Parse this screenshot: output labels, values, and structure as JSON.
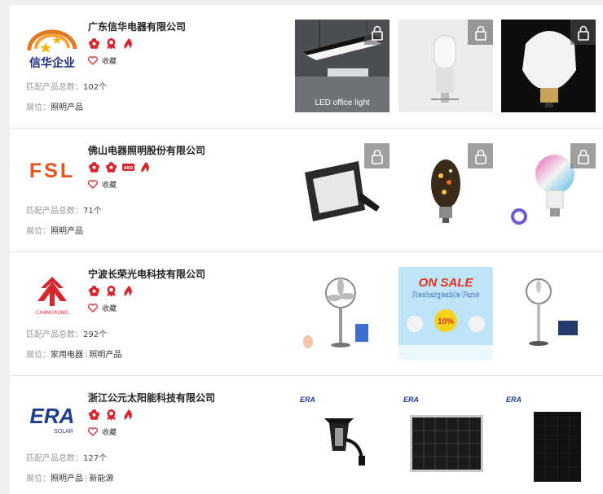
{
  "labels": {
    "favorite": "收藏",
    "product_count": "匹配产品总数：",
    "hall": "展位：",
    "count_suffix": "个"
  },
  "colors": {
    "badge_red": "#d8262e",
    "link": "#333333"
  },
  "companies": [
    {
      "name": "广东信华电器有限公司",
      "logo_text": "信华企业",
      "badges": [
        "flower-badge-icon",
        "award-badge-icon",
        "flame-badge-icon"
      ],
      "product_count": "102",
      "halls": [
        "照明产品"
      ],
      "thumbs": [
        {
          "icon": "led-office-light-image",
          "caption": "LED office light",
          "locked": true
        },
        {
          "icon": "led-corn-bulb-image",
          "caption": "",
          "locked": true
        },
        {
          "icon": "led-bulb-image",
          "caption": "",
          "locked": true
        }
      ]
    },
    {
      "name": "佛山电器照明股份有限公司",
      "logo_text": "FSL",
      "badges": [
        "flower-badge-icon",
        "flower-badge-icon",
        "aeo-badge-icon",
        "flame-badge-icon"
      ],
      "aeo_text": "AEO",
      "product_count": "71",
      "halls": [
        "照明产品"
      ],
      "thumbs": [
        {
          "icon": "floodlight-image",
          "caption": "",
          "locked": true
        },
        {
          "icon": "fireworks-bulb-image",
          "caption": "",
          "locked": true
        },
        {
          "icon": "rgb-smart-bulb-image",
          "caption": "",
          "locked": true
        }
      ]
    },
    {
      "name": "宁波长荣光电科技有限公司",
      "logo_text": "CHANGRONG",
      "badges": [
        "flower-badge-icon",
        "award-badge-icon",
        "flame-badge-icon"
      ],
      "product_count": "292",
      "halls": [
        "家用电器",
        "照明产品"
      ],
      "thumbs": [
        {
          "icon": "standing-fan-solar-image",
          "caption": "",
          "locked": false
        },
        {
          "icon": "rechargeable-fans-sale-image",
          "caption": "",
          "sale_title": "ON SALE",
          "sale_sub": "Rechargeable Fans",
          "sale_pct": "10%",
          "locked": false
        },
        {
          "icon": "solar-standing-fan-image",
          "caption": "",
          "locked": false
        }
      ]
    },
    {
      "name": "浙江公元太阳能科技有限公司",
      "logo_text": "ERA",
      "logo_sub": "SOLAR",
      "badges": [
        "flower-badge-icon",
        "award-badge-icon",
        "flame-badge-icon"
      ],
      "product_count": "127",
      "halls": [
        "照明产品",
        "新能源"
      ],
      "thumbs": [
        {
          "icon": "solar-wall-lantern-image",
          "caption": "",
          "brand": "ERA",
          "locked": false
        },
        {
          "icon": "solar-panel-framed-image",
          "caption": "",
          "brand": "ERA",
          "locked": false
        },
        {
          "icon": "solar-panel-black-image",
          "caption": "",
          "brand": "ERA",
          "locked": false
        }
      ]
    }
  ]
}
